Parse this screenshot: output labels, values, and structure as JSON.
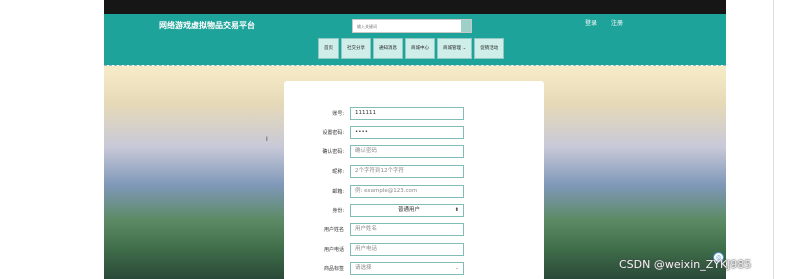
{
  "header": {
    "site_title": "网络游戏虚拟物品交易平台",
    "search_placeholder": "输入关键词",
    "login": "登录",
    "register": "注册"
  },
  "nav": [
    "首页",
    "社交分享",
    "通知消息",
    "商城中心",
    "商城管理",
    "促销活动"
  ],
  "form": {
    "rows": [
      {
        "label": "账号:",
        "value": "111111",
        "placeholder": false
      },
      {
        "label": "设置密码:",
        "value": "••••",
        "placeholder": false
      },
      {
        "label": "确认密码:",
        "value": "确认密码",
        "placeholder": true
      },
      {
        "label": "昵称:",
        "value": "2个字符到12个字符",
        "placeholder": true
      },
      {
        "label": "邮箱:",
        "value": "例: example@123.com",
        "placeholder": true
      },
      {
        "label": "身份:",
        "value": "普通用户",
        "placeholder": false,
        "select": true
      },
      {
        "label": "用户姓名",
        "value": "用户姓名",
        "placeholder": true
      },
      {
        "label": "用户电话",
        "value": "用户电话",
        "placeholder": true
      },
      {
        "label": "商品标签",
        "value": "请选择",
        "placeholder": true,
        "select": true
      }
    ]
  },
  "watermark": "CSDN @weixin_ZYKJ985",
  "colors": {
    "header": "#1ea39a",
    "topbar": "#161616",
    "field_border": "#7fbdb6"
  }
}
